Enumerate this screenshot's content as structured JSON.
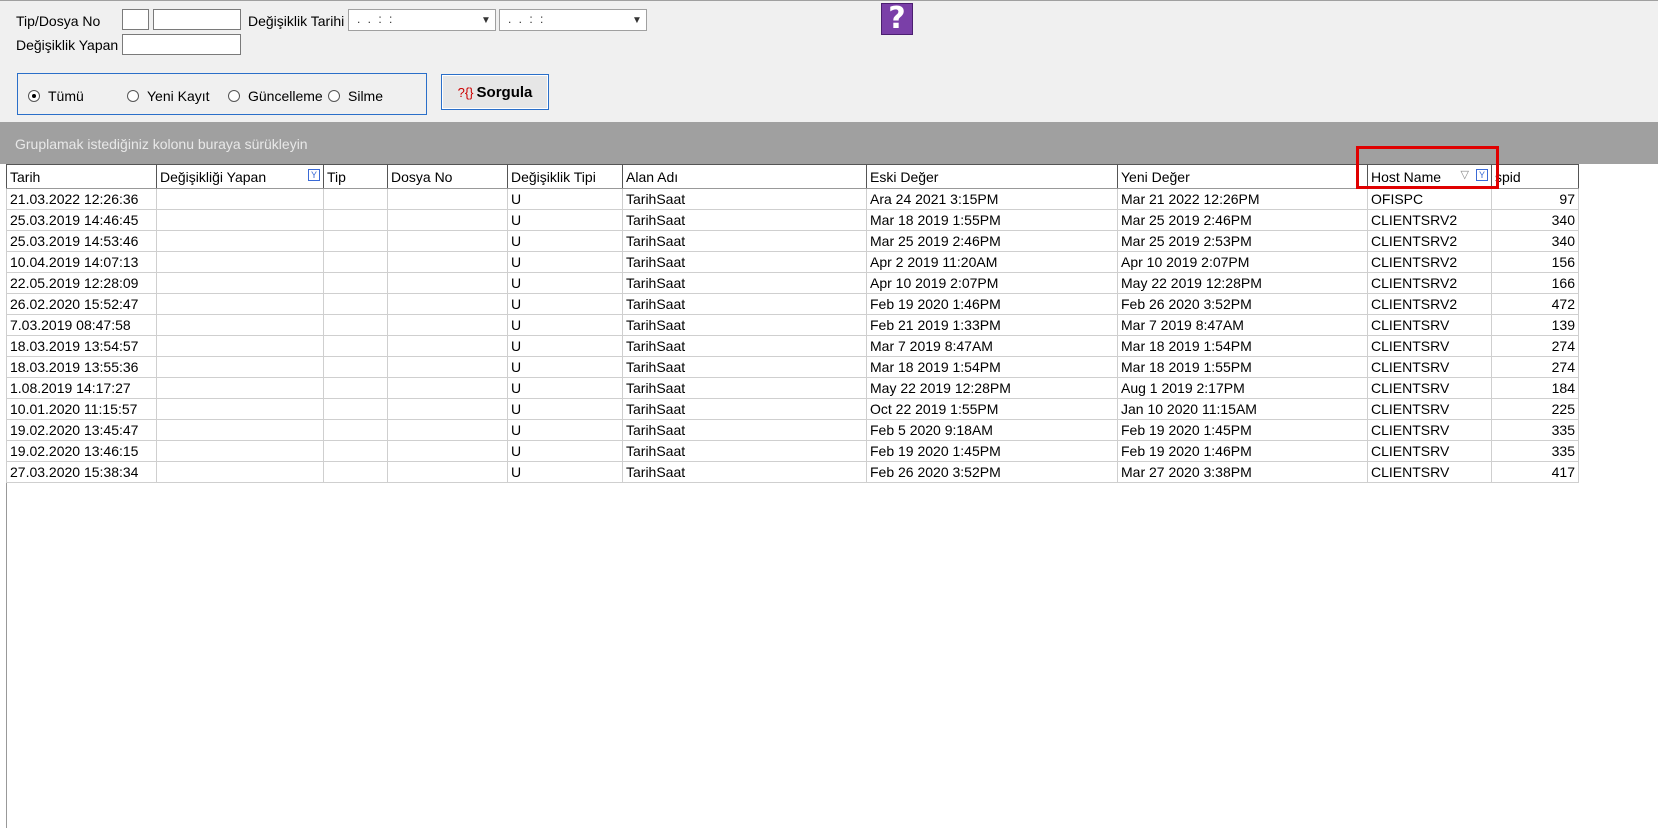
{
  "filters": {
    "tip_dosya_label": "Tip/Dosya No",
    "degisiklik_yapan_label": "Değişiklik Yapan",
    "degisiklik_tarihi_label": "Değişiklik Tarihi",
    "date_mask": ". .   : :"
  },
  "help_button": "?",
  "radio_group": {
    "options": [
      {
        "label": "Tümü",
        "selected": true
      },
      {
        "label": "Yeni Kayıt",
        "selected": false
      },
      {
        "label": "Güncelleme",
        "selected": false
      },
      {
        "label": "Silme",
        "selected": false
      }
    ]
  },
  "sorgula_button": {
    "icon": "?{}",
    "label": "Sorgula"
  },
  "group_hint": "Gruplamak istediğiniz kolonu buraya sürükleyin",
  "grid": {
    "columns": [
      "Tarih",
      "Değişikliği Yapan",
      "Tip",
      "Dosya No",
      "Değişiklik Tipi",
      "Alan Adı",
      "Eski Değer",
      "Yeni Değer",
      "Host Name",
      "spid"
    ],
    "rows": [
      [
        "21.03.2022 12:26:36",
        "",
        "",
        "",
        "U",
        "TarihSaat",
        "Ara 24 2021  3:15PM",
        "Mar 21 2022 12:26PM",
        "OFISPC",
        "97"
      ],
      [
        "25.03.2019 14:46:45",
        "",
        "",
        "",
        "U",
        "TarihSaat",
        "Mar 18 2019  1:55PM",
        "Mar 25 2019  2:46PM",
        "CLIENTSRV2",
        "340"
      ],
      [
        "25.03.2019 14:53:46",
        "",
        "",
        "",
        "U",
        "TarihSaat",
        "Mar 25 2019  2:46PM",
        "Mar 25 2019  2:53PM",
        "CLIENTSRV2",
        "340"
      ],
      [
        "10.04.2019 14:07:13",
        "",
        "",
        "",
        "U",
        "TarihSaat",
        "Apr  2 2019 11:20AM",
        "Apr 10 2019  2:07PM",
        "CLIENTSRV2",
        "156"
      ],
      [
        "22.05.2019 12:28:09",
        "",
        "",
        "",
        "U",
        "TarihSaat",
        "Apr 10 2019  2:07PM",
        "May 22 2019 12:28PM",
        "CLIENTSRV2",
        "166"
      ],
      [
        "26.02.2020 15:52:47",
        "",
        "",
        "",
        "U",
        "TarihSaat",
        "Feb 19 2020  1:46PM",
        "Feb 26 2020  3:52PM",
        "CLIENTSRV2",
        "472"
      ],
      [
        "7.03.2019 08:47:58",
        "",
        "",
        "",
        "U",
        "TarihSaat",
        "Feb 21 2019  1:33PM",
        "Mar  7 2019  8:47AM",
        "CLIENTSRV",
        "139"
      ],
      [
        "18.03.2019 13:54:57",
        "",
        "",
        "",
        "U",
        "TarihSaat",
        "Mar  7 2019  8:47AM",
        "Mar 18 2019  1:54PM",
        "CLIENTSRV",
        "274"
      ],
      [
        "18.03.2019 13:55:36",
        "",
        "",
        "",
        "U",
        "TarihSaat",
        "Mar 18 2019  1:54PM",
        "Mar 18 2019  1:55PM",
        "CLIENTSRV",
        "274"
      ],
      [
        "1.08.2019 14:17:27",
        "",
        "",
        "",
        "U",
        "TarihSaat",
        "May 22 2019 12:28PM",
        "Aug  1 2019  2:17PM",
        "CLIENTSRV",
        "184"
      ],
      [
        "10.01.2020 11:15:57",
        "",
        "",
        "",
        "U",
        "TarihSaat",
        "Oct 22 2019  1:55PM",
        "Jan 10 2020 11:15AM",
        "CLIENTSRV",
        "225"
      ],
      [
        "19.02.2020 13:45:47",
        "",
        "",
        "",
        "U",
        "TarihSaat",
        "Feb  5 2020  9:18AM",
        "Feb 19 2020  1:45PM",
        "CLIENTSRV",
        "335"
      ],
      [
        "19.02.2020 13:46:15",
        "",
        "",
        "",
        "U",
        "TarihSaat",
        "Feb 19 2020  1:45PM",
        "Feb 19 2020  1:46PM",
        "CLIENTSRV",
        "335"
      ],
      [
        "27.03.2020 15:38:34",
        "",
        "",
        "",
        "U",
        "TarihSaat",
        "Feb 26 2020  3:52PM",
        "Mar 27 2020  3:38PM",
        "CLIENTSRV",
        "417"
      ]
    ]
  },
  "colors": {
    "highlight": "#e00000",
    "accent": "#2a6fc9",
    "help": "#7a3fa8"
  }
}
